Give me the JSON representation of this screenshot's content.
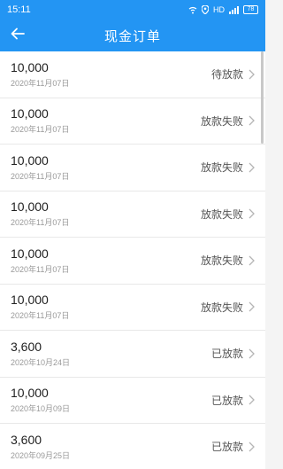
{
  "status_bar": {
    "time": "15:11",
    "network": "HD",
    "battery": "78"
  },
  "header": {
    "title": "现金订单",
    "back_icon": "arrow-left-icon"
  },
  "orders": [
    {
      "amount": "10,000",
      "date": "2020年11月07日",
      "status": "待放款"
    },
    {
      "amount": "10,000",
      "date": "2020年11月07日",
      "status": "放款失败"
    },
    {
      "amount": "10,000",
      "date": "2020年11月07日",
      "status": "放款失败"
    },
    {
      "amount": "10,000",
      "date": "2020年11月07日",
      "status": "放款失败"
    },
    {
      "amount": "10,000",
      "date": "2020年11月07日",
      "status": "放款失败"
    },
    {
      "amount": "10,000",
      "date": "2020年11月07日",
      "status": "放款失败"
    },
    {
      "amount": "3,600",
      "date": "2020年10月24日",
      "status": "已放款"
    },
    {
      "amount": "10,000",
      "date": "2020年10月09日",
      "status": "已放款"
    },
    {
      "amount": "3,600",
      "date": "2020年09月25日",
      "status": "已放款"
    }
  ],
  "colors": {
    "primary": "#2395f3"
  }
}
